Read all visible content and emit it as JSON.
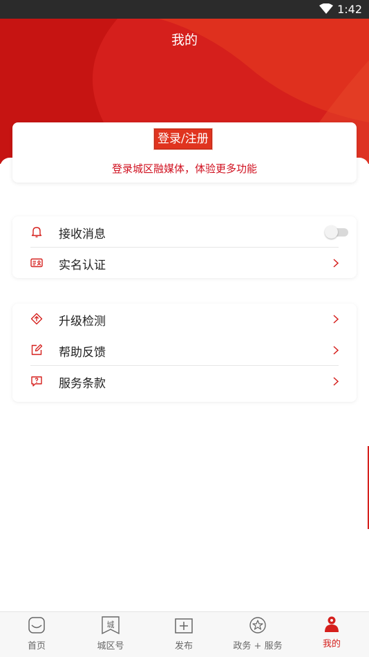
{
  "status_bar": {
    "time": "1:42"
  },
  "header": {
    "title": "我的"
  },
  "login_card": {
    "button_label": "登录/注册",
    "hint": "登录城区融媒体，体验更多功能"
  },
  "settings_group_1": [
    {
      "label": "接收消息",
      "icon": "bell-icon",
      "control": "toggle",
      "enabled": false
    },
    {
      "label": "实名认证",
      "icon": "id-card-icon",
      "control": "chevron"
    }
  ],
  "settings_group_2": [
    {
      "label": "升级检测",
      "icon": "upgrade-icon",
      "control": "chevron"
    },
    {
      "label": "帮助反馈",
      "icon": "edit-icon",
      "control": "chevron"
    },
    {
      "label": "服务条款",
      "icon": "chat-help-icon",
      "control": "chevron"
    }
  ],
  "tab_bar": {
    "tabs": [
      {
        "label": "首页",
        "icon": "home-icon"
      },
      {
        "label": "城区号",
        "icon": "city-badge-icon"
      },
      {
        "label": "发布",
        "icon": "plus-square-icon"
      },
      {
        "label": "政务 + 服务",
        "icon": "star-badge-icon"
      },
      {
        "label": "我的",
        "icon": "person-icon",
        "active": true
      }
    ]
  },
  "colors": {
    "brand": "#d51f1c",
    "brand_dark": "#b8120f",
    "text": "#222222"
  }
}
